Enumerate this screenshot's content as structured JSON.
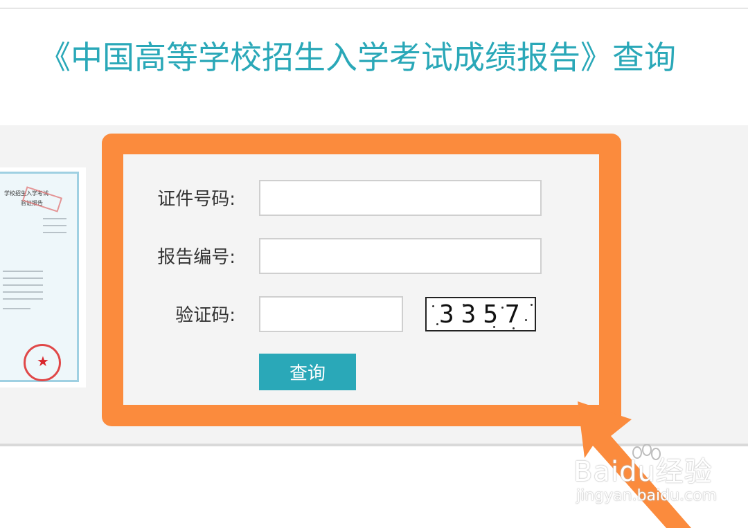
{
  "page": {
    "title": "《中国高等学校招生入学考试成绩报告》查询"
  },
  "certificate": {
    "caption_line1": "学校招生入学考试",
    "caption_line2": "验证报告",
    "stamp_text": "★"
  },
  "form": {
    "id_label": "证件号码:",
    "id_value": "",
    "report_label": "报告编号:",
    "report_value": "",
    "captcha_label": "验证码:",
    "captcha_value": "",
    "captcha_image_text": "3357",
    "submit_label": "查询"
  },
  "watermark": {
    "brand": "Baidu经验",
    "url": "jingyan.baidu.com"
  },
  "colors": {
    "accent": "#2aa8b8",
    "highlight": "#fb8b3d",
    "panel_bg": "#f4f4f4"
  },
  "icons": [
    "arrow-icon",
    "paw-icon"
  ]
}
